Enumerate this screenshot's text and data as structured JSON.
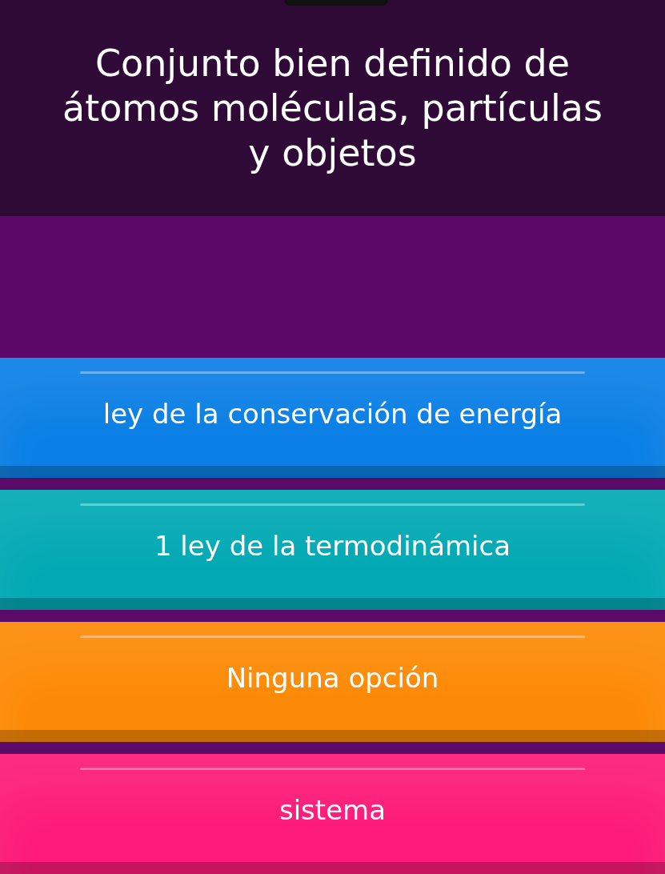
{
  "question": {
    "text": "Conjunto bien definido de átomos moléculas, partículas y objetos"
  },
  "answers": [
    {
      "label": "ley de la conservación de energía",
      "color": "#0b7fe6"
    },
    {
      "label": "1 ley de la termodinámica",
      "color": "#02a9b4"
    },
    {
      "label": "Ninguna opción",
      "color": "#fd8a06"
    },
    {
      "label": "sistema",
      "color": "#fd1a78"
    }
  ]
}
